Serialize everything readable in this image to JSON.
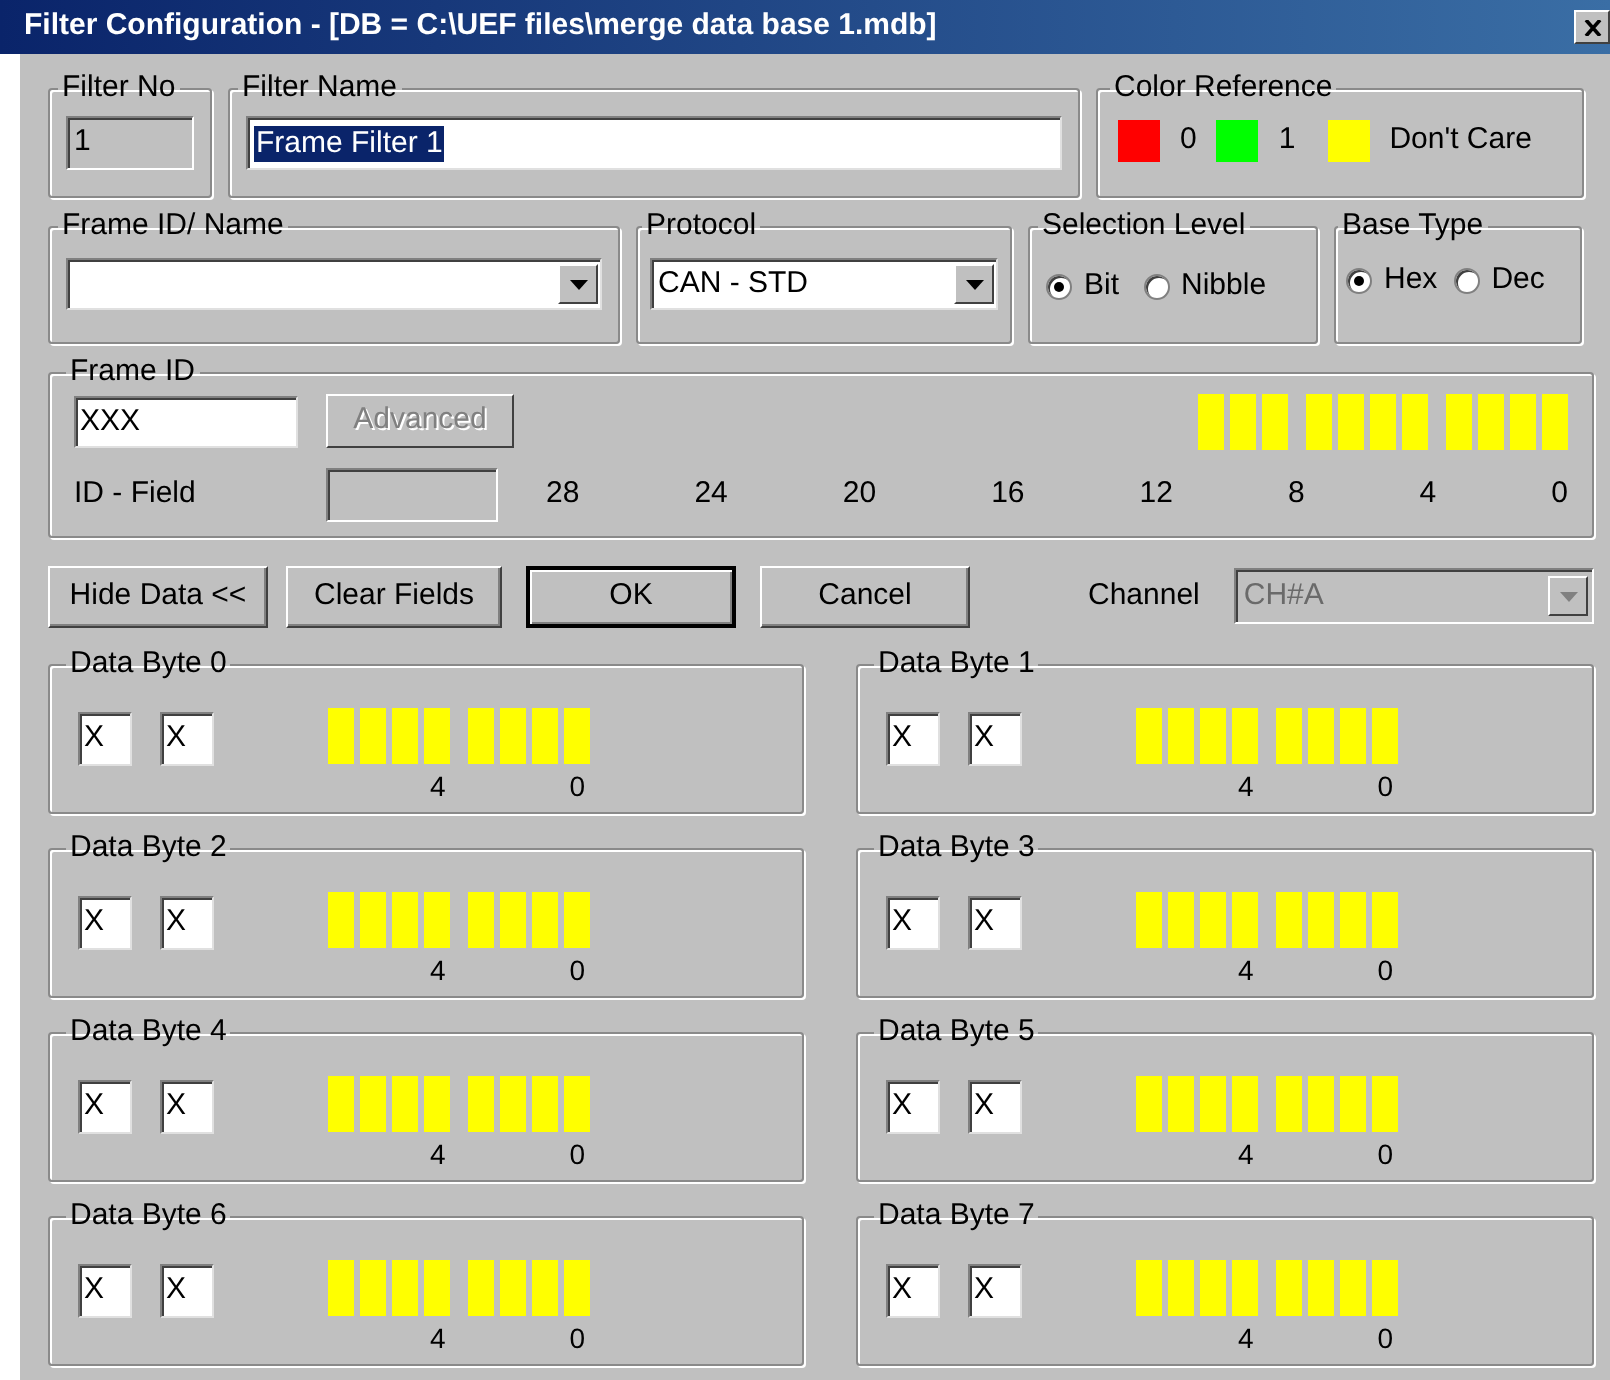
{
  "window": {
    "title": "Filter Configuration - [DB = C:\\UEF files\\merge data base 1.mdb]"
  },
  "filter_no": {
    "label": "Filter No",
    "value": "1"
  },
  "filter_name": {
    "label": "Filter Name",
    "value": "Frame Filter 1",
    "selected": true
  },
  "color_reference": {
    "label": "Color Reference",
    "items": [
      {
        "label": "0",
        "color": "#ff0000"
      },
      {
        "label": "1",
        "color": "#00ff00"
      },
      {
        "label": "Don't Care",
        "color": "#ffff00"
      }
    ]
  },
  "frame_id_name": {
    "label": "Frame ID/ Name"
  },
  "protocol": {
    "label": "Protocol",
    "value": "CAN - STD"
  },
  "selection_level": {
    "label": "Selection Level",
    "options": [
      {
        "label": "Bit",
        "selected": true
      },
      {
        "label": "Nibble",
        "selected": false
      }
    ]
  },
  "base_type": {
    "label": "Base Type",
    "options": [
      {
        "label": "Hex",
        "selected": true
      },
      {
        "label": "Dec",
        "selected": false
      }
    ]
  },
  "frame_id": {
    "label": "Frame ID",
    "value": "XXX",
    "advanced_button": {
      "label": "Advanced",
      "disabled": true
    },
    "id_field_label": "ID - Field",
    "bit_numbers": [
      "28",
      "24",
      "20",
      "16",
      "12",
      "8",
      "4",
      "0"
    ],
    "bits": [
      {
        "color": "#ffff00"
      },
      {
        "color": "#ffff00"
      },
      {
        "color": "#ffff00"
      },
      {
        "color": "#ffff00"
      },
      {
        "color": "#ffff00"
      },
      {
        "color": "#ffff00"
      },
      {
        "color": "#ffff00"
      },
      {
        "color": "#ffff00"
      },
      {
        "color": "#ffff00"
      },
      {
        "color": "#ffff00"
      },
      {
        "color": "#ffff00"
      }
    ]
  },
  "buttons": [
    {
      "label": "Hide Data <<",
      "default": false
    },
    {
      "label": "Clear Fields",
      "default": false
    },
    {
      "label": "OK",
      "default": true
    },
    {
      "label": "Cancel",
      "default": false
    }
  ],
  "channel": {
    "label": "Channel",
    "value": "CH#A",
    "disabled": true
  },
  "data_bytes": [
    {
      "label": "Data Byte 0",
      "fields": [
        "X",
        "X"
      ],
      "bit_numbers": [
        "4",
        "0"
      ],
      "bits": [
        {
          "color": "#ffff00"
        },
        {
          "color": "#ffff00"
        },
        {
          "color": "#ffff00"
        },
        {
          "color": "#ffff00"
        },
        {
          "color": "#ffff00"
        },
        {
          "color": "#ffff00"
        },
        {
          "color": "#ffff00"
        },
        {
          "color": "#ffff00"
        }
      ]
    },
    {
      "label": "Data Byte 1",
      "fields": [
        "X",
        "X"
      ],
      "bit_numbers": [
        "4",
        "0"
      ],
      "bits": [
        {
          "color": "#ffff00"
        },
        {
          "color": "#ffff00"
        },
        {
          "color": "#ffff00"
        },
        {
          "color": "#ffff00"
        },
        {
          "color": "#ffff00"
        },
        {
          "color": "#ffff00"
        },
        {
          "color": "#ffff00"
        },
        {
          "color": "#ffff00"
        }
      ]
    },
    {
      "label": "Data Byte 2",
      "fields": [
        "X",
        "X"
      ],
      "bit_numbers": [
        "4",
        "0"
      ],
      "bits": [
        {
          "color": "#ffff00"
        },
        {
          "color": "#ffff00"
        },
        {
          "color": "#ffff00"
        },
        {
          "color": "#ffff00"
        },
        {
          "color": "#ffff00"
        },
        {
          "color": "#ffff00"
        },
        {
          "color": "#ffff00"
        },
        {
          "color": "#ffff00"
        }
      ]
    },
    {
      "label": "Data Byte 3",
      "fields": [
        "X",
        "X"
      ],
      "bit_numbers": [
        "4",
        "0"
      ],
      "bits": [
        {
          "color": "#ffff00"
        },
        {
          "color": "#ffff00"
        },
        {
          "color": "#ffff00"
        },
        {
          "color": "#ffff00"
        },
        {
          "color": "#ffff00"
        },
        {
          "color": "#ffff00"
        },
        {
          "color": "#ffff00"
        },
        {
          "color": "#ffff00"
        }
      ]
    },
    {
      "label": "Data Byte 4",
      "fields": [
        "X",
        "X"
      ],
      "bit_numbers": [
        "4",
        "0"
      ],
      "bits": [
        {
          "color": "#ffff00"
        },
        {
          "color": "#ffff00"
        },
        {
          "color": "#ffff00"
        },
        {
          "color": "#ffff00"
        },
        {
          "color": "#ffff00"
        },
        {
          "color": "#ffff00"
        },
        {
          "color": "#ffff00"
        },
        {
          "color": "#ffff00"
        }
      ]
    },
    {
      "label": "Data Byte 5",
      "fields": [
        "X",
        "X"
      ],
      "bit_numbers": [
        "4",
        "0"
      ],
      "bits": [
        {
          "color": "#ffff00"
        },
        {
          "color": "#ffff00"
        },
        {
          "color": "#ffff00"
        },
        {
          "color": "#ffff00"
        },
        {
          "color": "#ffff00"
        },
        {
          "color": "#ffff00"
        },
        {
          "color": "#ffff00"
        },
        {
          "color": "#ffff00"
        }
      ]
    },
    {
      "label": "Data Byte 6",
      "fields": [
        "X",
        "X"
      ],
      "bit_numbers": [
        "4",
        "0"
      ],
      "bits": [
        {
          "color": "#ffff00"
        },
        {
          "color": "#ffff00"
        },
        {
          "color": "#ffff00"
        },
        {
          "color": "#ffff00"
        },
        {
          "color": "#ffff00"
        },
        {
          "color": "#ffff00"
        },
        {
          "color": "#ffff00"
        },
        {
          "color": "#ffff00"
        }
      ]
    },
    {
      "label": "Data Byte 7",
      "fields": [
        "X",
        "X"
      ],
      "bit_numbers": [
        "4",
        "0"
      ],
      "bits": [
        {
          "color": "#ffff00"
        },
        {
          "color": "#ffff00"
        },
        {
          "color": "#ffff00"
        },
        {
          "color": "#ffff00"
        },
        {
          "color": "#ffff00"
        },
        {
          "color": "#ffff00"
        },
        {
          "color": "#ffff00"
        },
        {
          "color": "#ffff00"
        }
      ]
    }
  ]
}
